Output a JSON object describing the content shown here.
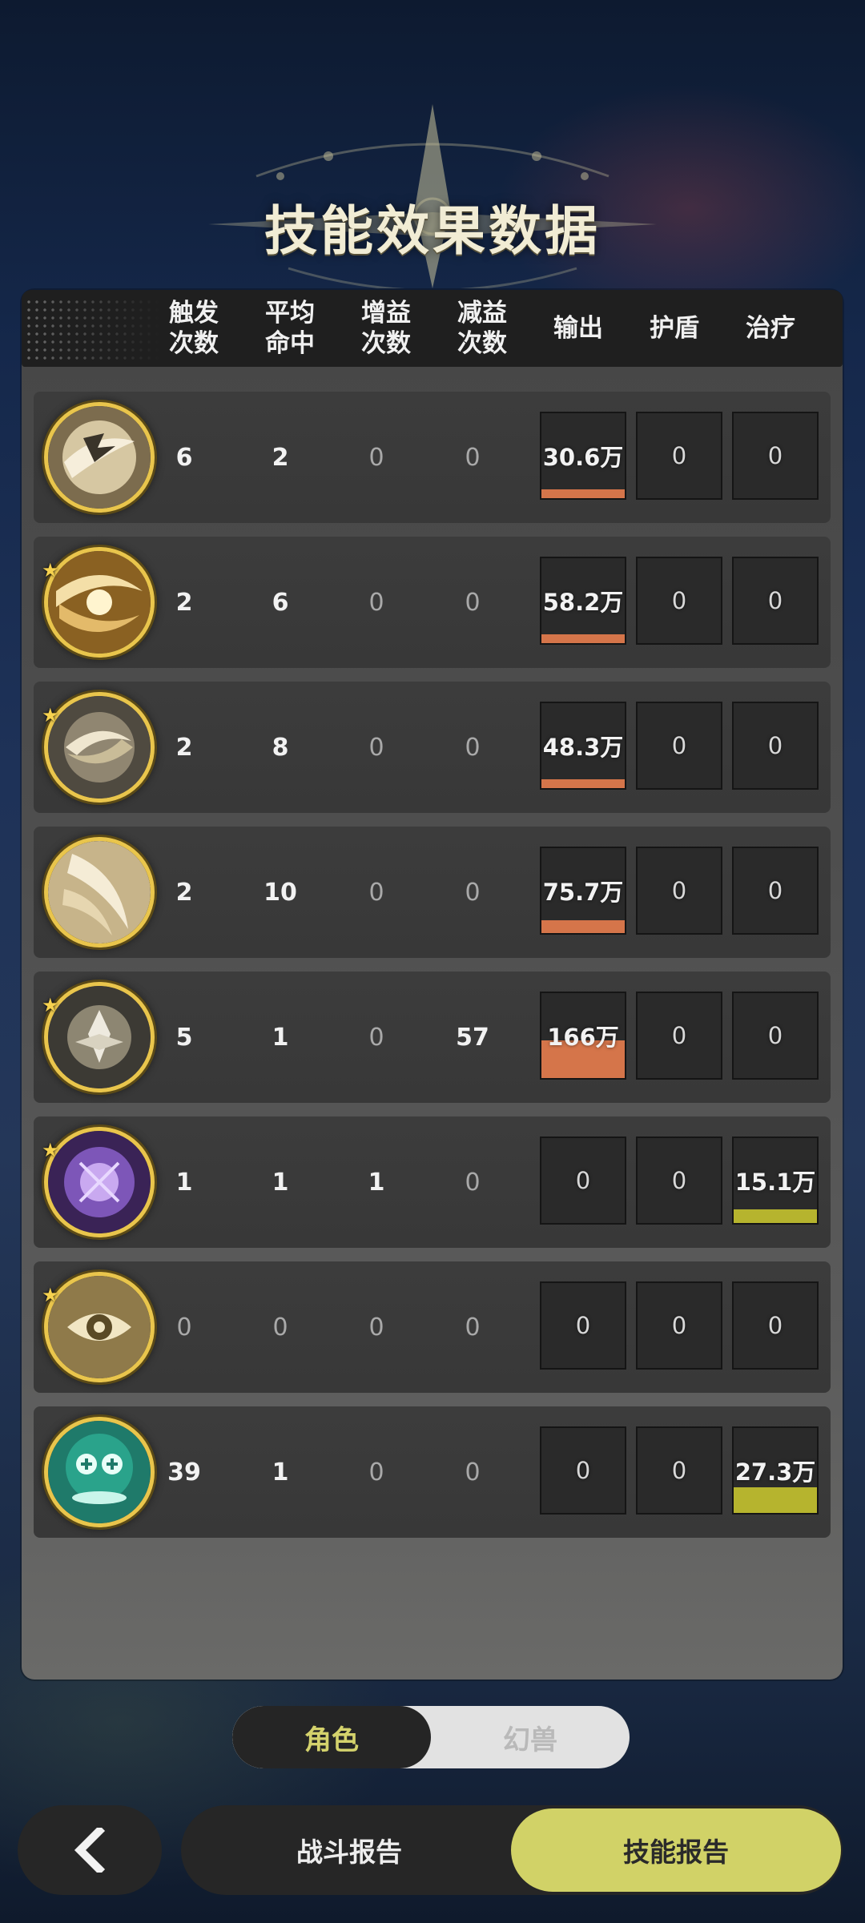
{
  "page_title": "技能效果数据",
  "columns": [
    "触发\n次数",
    "平均\n命中",
    "增益\n次数",
    "减益\n次数",
    "输出",
    "护盾",
    "治疗"
  ],
  "colors": {
    "output_bar": "#d5754a",
    "heal_bar": "#b6b42e",
    "accent": "#d1d267"
  },
  "rows": [
    {
      "icon": "hand-sweep-skill-icon",
      "starred": false,
      "trigger": "6",
      "hits": "2",
      "buffs": "0",
      "debuffs": "0",
      "output": "30.6万",
      "shield": "0",
      "heal": "0",
      "output_bar_fraction": 0.1,
      "heal_bar_fraction": 0
    },
    {
      "icon": "golden-slash-skill-icon",
      "starred": true,
      "trigger": "2",
      "hits": "6",
      "buffs": "0",
      "debuffs": "0",
      "output": "58.2万",
      "shield": "0",
      "heal": "0",
      "output_bar_fraction": 0.1,
      "heal_bar_fraction": 0
    },
    {
      "icon": "whirl-skill-icon",
      "starred": true,
      "trigger": "2",
      "hits": "8",
      "buffs": "0",
      "debuffs": "0",
      "output": "48.3万",
      "shield": "0",
      "heal": "0",
      "output_bar_fraction": 0.1,
      "heal_bar_fraction": 0
    },
    {
      "icon": "wind-slash-skill-icon",
      "starred": false,
      "trigger": "2",
      "hits": "10",
      "buffs": "0",
      "debuffs": "0",
      "output": "75.7万",
      "shield": "0",
      "heal": "0",
      "output_bar_fraction": 0.15,
      "heal_bar_fraction": 0
    },
    {
      "icon": "leaf-emblem-skill-icon",
      "starred": true,
      "trigger": "5",
      "hits": "1",
      "buffs": "0",
      "debuffs": "57",
      "output": "166万",
      "shield": "0",
      "heal": "0",
      "output_bar_fraction": 0.44,
      "heal_bar_fraction": 0
    },
    {
      "icon": "purple-orb-skill-icon",
      "starred": true,
      "trigger": "1",
      "hits": "1",
      "buffs": "1",
      "debuffs": "0",
      "output": "0",
      "shield": "0",
      "heal": "15.1万",
      "output_bar_fraction": 0,
      "heal_bar_fraction": 0.16
    },
    {
      "icon": "eye-skill-icon",
      "starred": true,
      "trigger": "0",
      "hits": "0",
      "buffs": "0",
      "debuffs": "0",
      "output": "0",
      "shield": "0",
      "heal": "0",
      "output_bar_fraction": 0,
      "heal_bar_fraction": 0
    },
    {
      "icon": "heal-plus-skill-icon",
      "starred": false,
      "trigger": "39",
      "hits": "1",
      "buffs": "0",
      "debuffs": "0",
      "output": "0",
      "shield": "0",
      "heal": "27.3万",
      "output_bar_fraction": 0,
      "heal_bar_fraction": 0.3
    }
  ],
  "toggle": {
    "active": "角色",
    "inactive": "幻兽"
  },
  "bottom": {
    "back_icon": "chevron-left-icon",
    "battle_report": "战斗报告",
    "skill_report": "技能报告"
  }
}
